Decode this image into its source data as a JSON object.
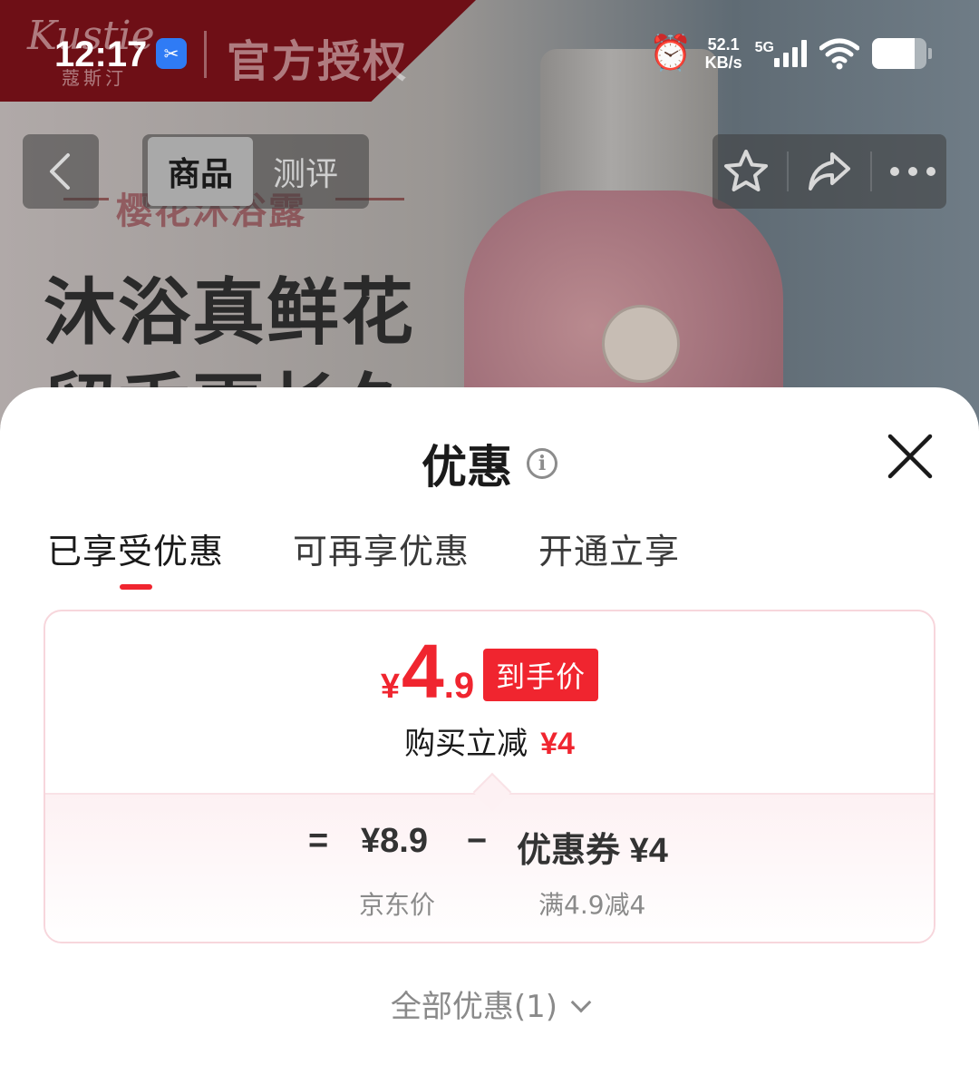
{
  "status_bar": {
    "time": "12:17",
    "net_speed_value": "52.1",
    "net_speed_unit": "KB/s",
    "network": "5G",
    "icons": [
      "screenshot-app-icon",
      "alarm-icon",
      "signal-icon",
      "wifi-icon",
      "battery-icon"
    ]
  },
  "background": {
    "brand": "Kustie",
    "brand_sub": "蔻斯汀",
    "authorization": "官方授权",
    "subtitle": "樱花沐浴露",
    "headline_1": "沐浴真鲜花",
    "headline_2": "留香更长久"
  },
  "nav": {
    "tabs": [
      "商品",
      "测评"
    ],
    "active_tab": "商品",
    "icons": [
      "back-icon",
      "star-icon",
      "share-icon",
      "more-icon"
    ]
  },
  "sheet": {
    "title": "优惠",
    "info_icon": "i",
    "tabs": [
      {
        "label": "已享受优惠",
        "active": true
      },
      {
        "label": "可再享优惠",
        "active": false
      },
      {
        "label": "开通立享",
        "active": false
      }
    ],
    "card": {
      "currency": "¥",
      "price_int": "4",
      "price_dec": ".9",
      "badge": "到手价",
      "save_label": "购买立减",
      "save_amount": "¥4",
      "formula": {
        "equals": "=",
        "jd_price": "¥8.9",
        "minus": "−",
        "coupon": "优惠券 ¥4",
        "jd_price_label": "京东价",
        "coupon_condition": "满4.9减4"
      }
    },
    "all_deals": "全部优惠(1)"
  },
  "colors": {
    "accent_red": "#f0252f",
    "card_border": "#f7d6dc"
  }
}
